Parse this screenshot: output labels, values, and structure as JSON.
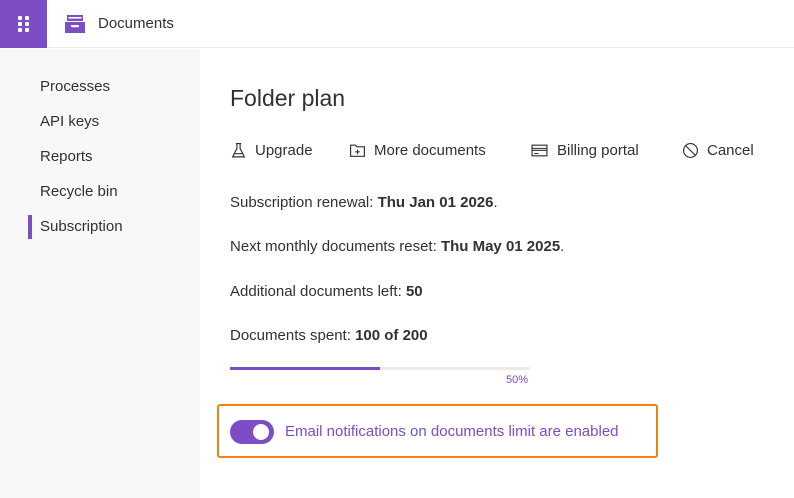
{
  "header": {
    "app_title": "Documents",
    "app_launcher_icon": "waffle-icon",
    "app_icon": "archive-drawer-icon",
    "accent_color": "#7c4dc4"
  },
  "sidebar": {
    "selected": "Subscription",
    "items": [
      {
        "label": "Processes"
      },
      {
        "label": "API keys"
      },
      {
        "label": "Reports"
      },
      {
        "label": "Recycle bin"
      },
      {
        "label": "Subscription"
      }
    ]
  },
  "main": {
    "title": "Folder plan",
    "commands": [
      {
        "label": "Upgrade",
        "icon": "flask-icon"
      },
      {
        "label": "More documents",
        "icon": "add-folder-icon"
      },
      {
        "label": "Billing portal",
        "icon": "credit-card-icon"
      },
      {
        "label": "Cancel",
        "icon": "prohibited-icon"
      }
    ],
    "renewal": {
      "label": "Subscription renewal: ",
      "value": "Thu Jan 01 2026",
      "suffix": "."
    },
    "reset": {
      "label": "Next monthly documents reset: ",
      "value": "Thu May 01 2025",
      "suffix": "."
    },
    "additional": {
      "label": "Additional documents left: ",
      "value": "50"
    },
    "spent": {
      "label": "Documents spent: ",
      "value": "100 of 200"
    },
    "progress": {
      "fraction": 0.5,
      "label": "50%"
    },
    "notifications": {
      "enabled": true,
      "label": "Email notifications on documents limit are enabled",
      "highlight_color": "#f0820f"
    }
  }
}
